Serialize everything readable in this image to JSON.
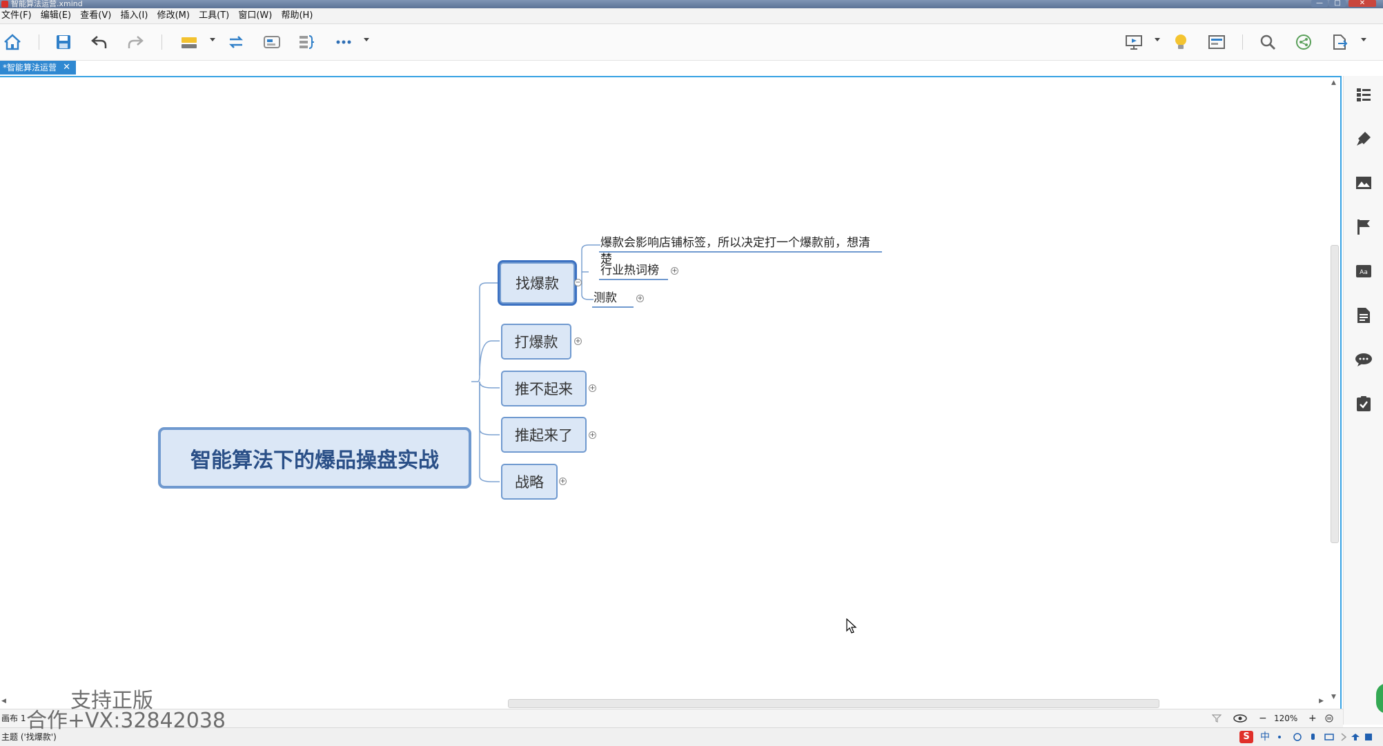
{
  "window": {
    "title": "智能算法运营.xmind"
  },
  "menu": [
    "文件(F)",
    "编辑(E)",
    "查看(V)",
    "插入(I)",
    "修改(M)",
    "工具(T)",
    "窗口(W)",
    "帮助(H)"
  ],
  "tab": {
    "label": "*智能算法运营",
    "close": "✕"
  },
  "mindmap": {
    "central": "智能算法下的爆品操盘实战",
    "branches": [
      "找爆款",
      "打爆款",
      "推不起来",
      "推起来了",
      "战略"
    ],
    "subtopics": [
      "爆款会影响店铺标签，所以决定打一个爆款前，想清楚",
      "行业热词榜",
      "测款"
    ]
  },
  "watermark": {
    "line1": "支持正版",
    "line2": "合作+VX:32842038"
  },
  "sheet": {
    "label": "画布 1"
  },
  "zoom": {
    "level": "120%",
    "minus": "−",
    "plus": "+"
  },
  "status": {
    "text": "主题 ('找爆款')",
    "ime": "中"
  },
  "icons": {
    "toolbar": [
      "home-icon",
      "save-icon",
      "undo-icon",
      "redo-icon",
      "insert-topic-icon",
      "relationship-icon",
      "boundary-icon",
      "summary-icon",
      "more-icon",
      "presentation-icon",
      "idea-icon",
      "layout-icon",
      "search-icon",
      "share-icon",
      "export-icon"
    ],
    "rightpanel": [
      "outline-icon",
      "format-icon",
      "image-icon",
      "marker-icon",
      "text-icon",
      "notes-icon",
      "comment-icon",
      "task-icon"
    ]
  },
  "colors": {
    "accent": "#2f88d1",
    "topic_fill": "#dbe7f6",
    "topic_border": "#6f99cf",
    "central_text": "#2a4f87"
  }
}
